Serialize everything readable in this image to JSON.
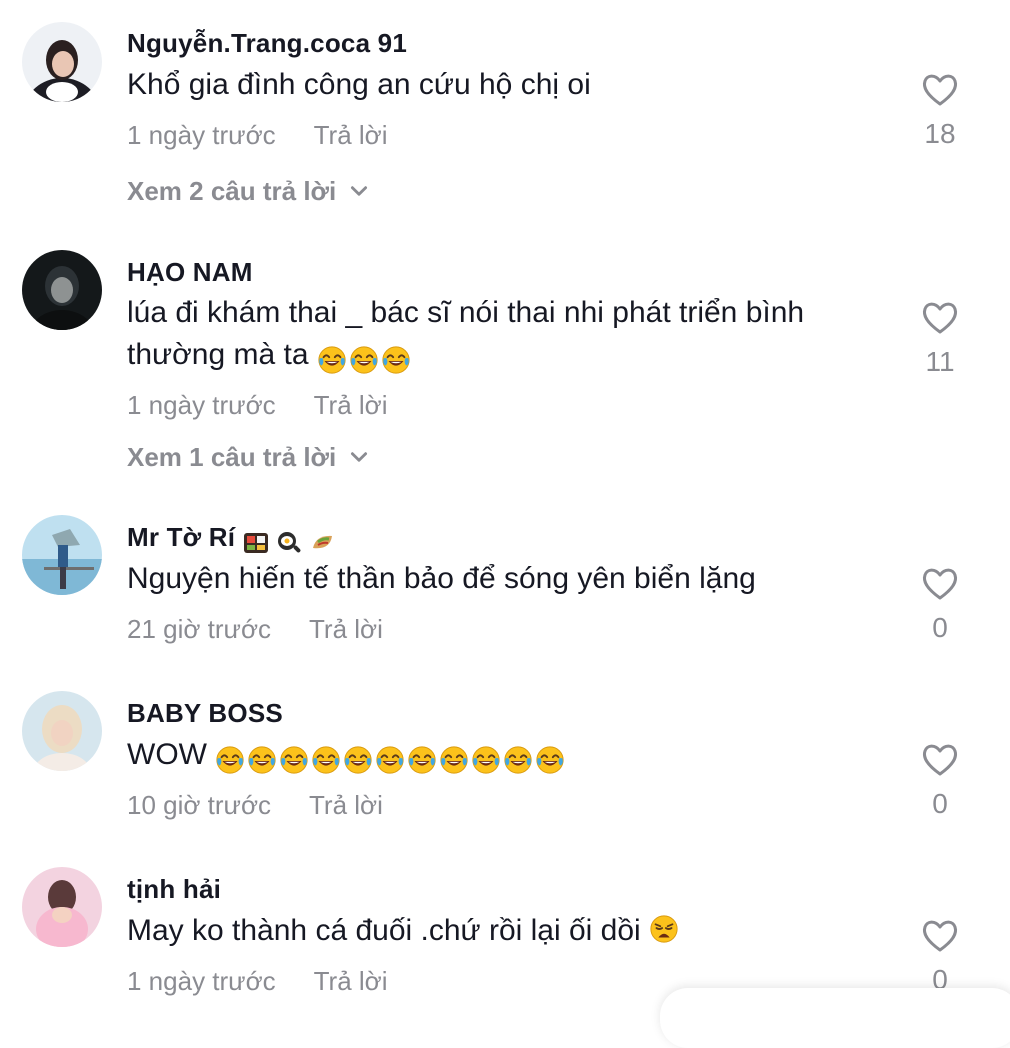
{
  "comments": [
    {
      "username": "Nguyễn.Trang.coca 91",
      "text": "Khổ gia đình công an cứu hộ chị oi",
      "time": "1 ngày trước",
      "reply_label": "Trả lời",
      "view_replies": "Xem 2 câu trả lời",
      "likes": "18"
    },
    {
      "username": "HẠO NAM",
      "text_line1": "lúa đi khám thai _ bác sĩ nói thai nhi phát triển bình",
      "text_line2": "thường mà ta",
      "emoji_count": 3,
      "time": "1 ngày trước",
      "reply_label": "Trả lời",
      "view_replies": "Xem 1 câu trả lời",
      "likes": "11"
    },
    {
      "username": "Mr Tờ Rí",
      "username_emojis": [
        "bento-box",
        "frying-pan-egg",
        "stuffed-flatbread"
      ],
      "text": "Nguyện hiến tế thần bảo để sóng yên biển lặng",
      "time": "21 giờ trước",
      "reply_label": "Trả lời",
      "likes": "0"
    },
    {
      "username": "BABY BOSS",
      "text": "WOW",
      "emoji_count": 11,
      "time": "10 giờ trước",
      "reply_label": "Trả lời",
      "likes": "0"
    },
    {
      "username": "tịnh hải",
      "text": "May ko thành cá đuối .chứ rồi lại ối dồi",
      "emoji": "weary-face",
      "time": "1 ngày trước",
      "reply_label": "Trả lời",
      "likes": "0"
    }
  ],
  "icons": {
    "like": "heart-outline-icon",
    "expand": "chevron-down-icon",
    "laugh": "face-with-tears-of-joy-emoji"
  },
  "colors": {
    "text": "#161823",
    "muted": "#8a8b91",
    "emoji_yellow": "#fcc21b",
    "emoji_tear": "#40a7e3"
  }
}
